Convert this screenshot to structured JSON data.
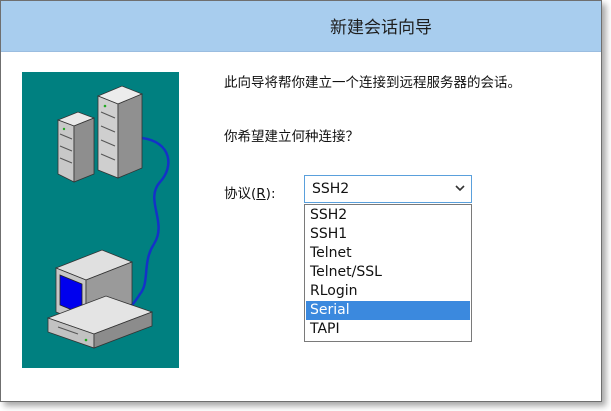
{
  "window": {
    "title": "新建会话向导"
  },
  "content": {
    "intro": "此向导将帮你建立一个连接到远程服务器的会话。",
    "question": "你希望建立何种连接？",
    "protocol_label_before": "协议(",
    "protocol_label_hotkey": "R",
    "protocol_label_after": "):"
  },
  "protocol_select": {
    "value": "SSH2",
    "options": [
      "SSH2",
      "SSH1",
      "Telnet",
      "Telnet/SSL",
      "RLogin",
      "Serial",
      "TAPI"
    ],
    "highlighted": "Serial"
  },
  "colors": {
    "title_bar": "#a8cdee",
    "illustration_bg": "#008080",
    "highlight": "#3b89de",
    "cable": "#1432c8"
  },
  "icons": {
    "dropdown": "chevron-down-icon",
    "servers": "server-icon",
    "computer": "computer-icon"
  }
}
